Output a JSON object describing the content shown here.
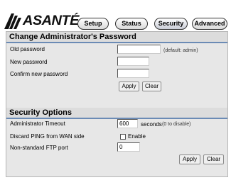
{
  "brand": {
    "logo_text": "ASANTÉ"
  },
  "nav": {
    "tabs": [
      {
        "label": "Setup"
      },
      {
        "label": "Status"
      },
      {
        "label": "Security",
        "active": true
      },
      {
        "label": "Advanced"
      }
    ]
  },
  "admin_password": {
    "title": "Change Administrator's Password",
    "old_password_label": "Old password",
    "old_password_value": "",
    "old_password_hint": "(default: admin)",
    "new_password_label": "New password",
    "new_password_value": "",
    "confirm_password_label": "Confirm new password",
    "confirm_password_value": "",
    "apply_label": "Apply",
    "clear_label": "Clear"
  },
  "security_options": {
    "title": "Security Options",
    "timeout_label": "Administrator Timeout",
    "timeout_value": "600",
    "timeout_suffix": "seconds",
    "timeout_hint": "(0 to disable)",
    "discard_ping_label": "Discard PING from WAN side",
    "discard_ping_checked": false,
    "discard_ping_enable_label": "Enable",
    "ftp_port_label": "Non-standard FTP port",
    "ftp_port_value": "0",
    "apply_label": "Apply",
    "clear_label": "Clear"
  },
  "colors": {
    "section_rule": "#6b8bb5",
    "panel_bg": "#e7e7e7"
  }
}
